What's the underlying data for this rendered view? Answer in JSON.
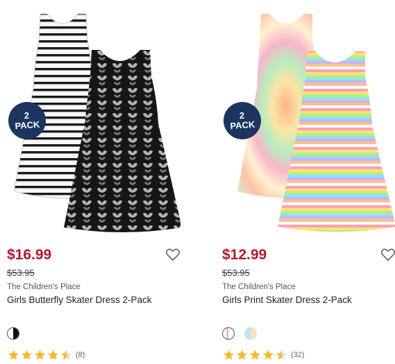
{
  "products": [
    {
      "badge": {
        "line1": "2",
        "line2": "PACK"
      },
      "price": "$16.99",
      "original_price": "$53.95",
      "brand": "The Children's Place",
      "title": "Girls Butterfly Skater Dress 2-Pack",
      "rating": {
        "stars": 4.5,
        "count": "(8)"
      },
      "swatches": [
        "black-white"
      ],
      "favorite_icon": "heart-outline-icon"
    },
    {
      "badge": {
        "line1": "2",
        "line2": "PACK"
      },
      "price": "$12.99",
      "original_price": "$53.95",
      "brand": "The Children's Place",
      "title": "Girls Print Skater Dress 2-Pack",
      "rating": {
        "stars": 4.5,
        "count": "(32)"
      },
      "swatches": [
        "pink-stripe",
        "pastel-tie-dye"
      ],
      "favorite_icon": "heart-outline-icon"
    }
  ],
  "colors": {
    "price": "#b5172c",
    "badge": "#1b3560",
    "star": "#f5b82e"
  }
}
